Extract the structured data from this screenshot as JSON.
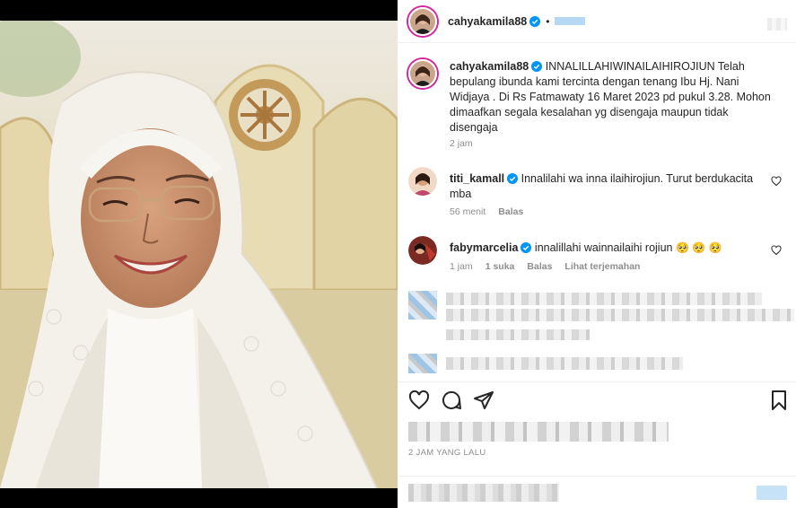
{
  "post": {
    "username": "cahyakamila88",
    "dot": "•",
    "caption": "INNALILLAHIWINAILAIHIROJIUN Telah bepulang ibunda kami tercinta dengan tenang Ibu Hj. Nani Widjaya . Di Rs Fatmawaty 16 Maret 2023 pd pukul 3.28. Mohon dimaafkan segala kesalahan yg disengaja maupun tidak disengaja",
    "caption_time": "2 jam",
    "time_ago": "2 JAM YANG LALU"
  },
  "comments": [
    {
      "username": "titi_kamall",
      "text": "Innalilahi wa inna ilaihirojiun. Turut berdukacita mba",
      "time": "56 menit",
      "reply": "Balas"
    },
    {
      "username": "fabymarcelia",
      "text": "innalillahi wainnailaihi rojiun",
      "emojis": "🥺 🥺 🥺",
      "time": "1 jam",
      "likes": "1 suka",
      "reply": "Balas",
      "translate": "Lihat terjemahan"
    }
  ],
  "icons": {
    "like": "heart-icon",
    "comment": "comment-icon",
    "share": "share-icon",
    "save": "bookmark-icon",
    "verified": "verified-badge-icon"
  },
  "colors": {
    "verified": "#0095f6",
    "meta": "#8e8e8e",
    "text": "#262626"
  }
}
